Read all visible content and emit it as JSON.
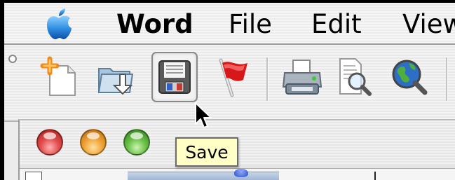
{
  "menubar": {
    "apple_icon": "apple-icon",
    "items": [
      "Word",
      "File",
      "Edit",
      "View"
    ]
  },
  "toolbar": {
    "buttons": [
      {
        "name": "new-document-icon"
      },
      {
        "name": "open-folder-icon"
      },
      {
        "name": "save-icon",
        "pressed": true
      },
      {
        "name": "flag-icon"
      },
      {
        "name": "print-icon"
      },
      {
        "name": "print-preview-icon"
      },
      {
        "name": "web-search-icon"
      }
    ]
  },
  "tooltip": {
    "text": "Save"
  },
  "colors": {
    "close": "#e45050",
    "minimize": "#f0a63a",
    "zoom": "#6dc24a",
    "tooltip_bg": "#ffffc6"
  }
}
